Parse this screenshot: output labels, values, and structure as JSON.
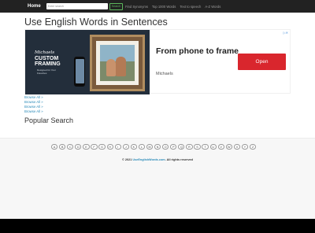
{
  "navbar": {
    "brand": "Home",
    "search_placeholder": "Enter search",
    "search_button": "Search",
    "links": [
      "Find Synonyms",
      "Top 1000 Words",
      "Text to speech",
      "A-Z Words"
    ]
  },
  "page": {
    "title": "Use English Words in Sentences"
  },
  "ad": {
    "brand": "Michaels",
    "title": "CUSTOM FRAMING",
    "subtitle": "Designed for Your Favorites",
    "headline": "From phone to frame",
    "advertiser": "Michaels",
    "cta": "Open"
  },
  "browse": {
    "links": [
      "Browse All »",
      "Browse All »",
      "Browse All »",
      "Browse All »"
    ]
  },
  "popular": {
    "heading": "Popular Search"
  },
  "footer": {
    "letters": [
      "A",
      "B",
      "C",
      "D",
      "E",
      "F",
      "G",
      "H",
      "I",
      "J",
      "K",
      "L",
      "M",
      "N",
      "O",
      "P",
      "Q",
      "R",
      "S",
      "T",
      "U",
      "V",
      "W",
      "X",
      "Y",
      "Z"
    ],
    "copyright_prefix": "© 2021 ",
    "site": "UseEnglishWords.com",
    "copyright_suffix": ". All rights reserved"
  },
  "colors": {
    "navbar": "#222222",
    "link": "#2a8ab8",
    "cta": "#d9262d",
    "search_button": "#5cb85c"
  }
}
